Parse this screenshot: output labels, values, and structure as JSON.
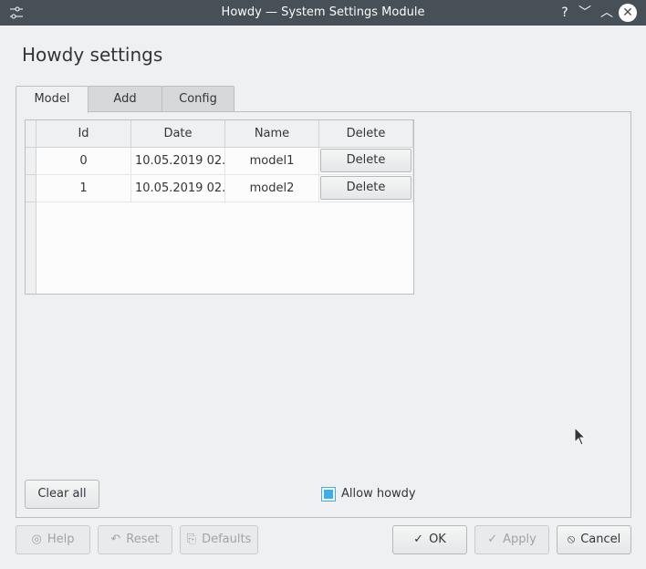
{
  "window": {
    "title": "Howdy — System Settings Module",
    "help_glyph": "?",
    "min_glyph": "﹀",
    "max_glyph": "︿",
    "close_glyph": "✕"
  },
  "page": {
    "heading": "Howdy settings"
  },
  "tabs": [
    {
      "label": "Model",
      "active": true
    },
    {
      "label": "Add",
      "active": false
    },
    {
      "label": "Config",
      "active": false
    }
  ],
  "table": {
    "columns": [
      "Id",
      "Date",
      "Name",
      "Delete"
    ],
    "rows": [
      {
        "id": "0",
        "date": "10.05.2019 02...",
        "name": "model1",
        "action": "Delete"
      },
      {
        "id": "1",
        "date": "10.05.2019 02...",
        "name": "model2",
        "action": "Delete"
      }
    ]
  },
  "actions": {
    "clear_all": "Clear all"
  },
  "allow_howdy": {
    "label": "Allow howdy",
    "checked": true
  },
  "footer": {
    "help": "Help",
    "reset": "Reset",
    "defaults": "Defaults",
    "ok": "OK",
    "apply": "Apply",
    "cancel": "Cancel"
  },
  "icons": {
    "help": "◎",
    "reset": "↶",
    "defaults": "⎘",
    "ok": "✓",
    "apply": "✓",
    "cancel": "⦸"
  },
  "colors": {
    "titlebar": "#475057",
    "accent": "#3daee9",
    "background": "#eff0f1"
  }
}
